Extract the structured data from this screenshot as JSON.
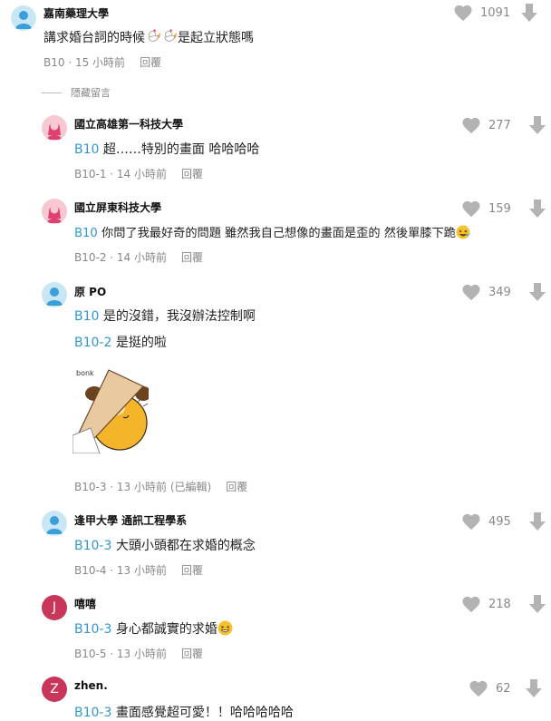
{
  "colors": {
    "accent": "#3397cf",
    "meta": "#888888",
    "icon": "#b3b3b3"
  },
  "hide_label": "隱藏留言",
  "comments": [
    {
      "author": "嘉南藥理大學",
      "avatar_type": "user-avatar",
      "avatar_bg": "#c9e6f5",
      "text_before": "講求婚台詞的時候",
      "emoji_1": "rooster-emoji",
      "emoji_2": "rooster-emoji",
      "text_after": "是起立狀態嗎",
      "floor": "B10",
      "time": "15 小時前",
      "reply": "回覆",
      "likes": "1091"
    },
    {
      "author": "國立高雄第一科技大學",
      "avatar_type": "female-avatar",
      "avatar_bg": "#f7c8d2",
      "ref": "B10",
      "text": " 超……特別的畫面 哈哈哈哈",
      "floor": "B10-1",
      "time": "14 小時前",
      "reply": "回覆",
      "likes": "277"
    },
    {
      "author": "國立屏東科技大學",
      "avatar_type": "female-avatar",
      "avatar_bg": "#f7c8d2",
      "ref": "B10",
      "text": " 你問了我最好奇的問題 雖然我自己想像的畫面是歪的 然後單膝下跪",
      "emoji": "laughing-emoji",
      "floor": "B10-2",
      "time": "14 小時前",
      "reply": "回覆",
      "likes": "159"
    },
    {
      "author": "原 PO",
      "avatar_type": "user-avatar",
      "avatar_bg": "#c9e6f5",
      "ref": "B10",
      "text": " 是的沒錯，我沒辦法控制啊",
      "ref_2": "B10-2",
      "text_2": " 是挺的啦",
      "sticker_text": "bonk",
      "floor": "B10-3",
      "time": "13 小時前 (已編輯)",
      "reply": "回覆",
      "likes": "349"
    },
    {
      "author": "逢甲大學 通訊工程學系",
      "avatar_type": "user-avatar",
      "avatar_bg": "#c9e6f5",
      "ref": "B10-3",
      "text": " 大頭小頭都在求婚的概念",
      "floor": "B10-4",
      "time": "13 小時前",
      "reply": "回覆",
      "likes": "495"
    },
    {
      "author": "嘻嘻",
      "avatar_type": "letter-avatar",
      "avatar_bg": "#c8375a",
      "avatar_letter": "J",
      "ref": "B10-3",
      "text": " 身心都誠實的求婚",
      "emoji": "grinning-emoji",
      "floor": "B10-5",
      "time": "13 小時前",
      "reply": "回覆",
      "likes": "218"
    },
    {
      "author": "zhen.",
      "avatar_type": "letter-avatar",
      "avatar_bg": "#c8375a",
      "avatar_letter": "Z",
      "ref": "B10-3",
      "text": " 畫面感覺超可愛！！哈哈哈哈哈",
      "likes": "62"
    }
  ]
}
